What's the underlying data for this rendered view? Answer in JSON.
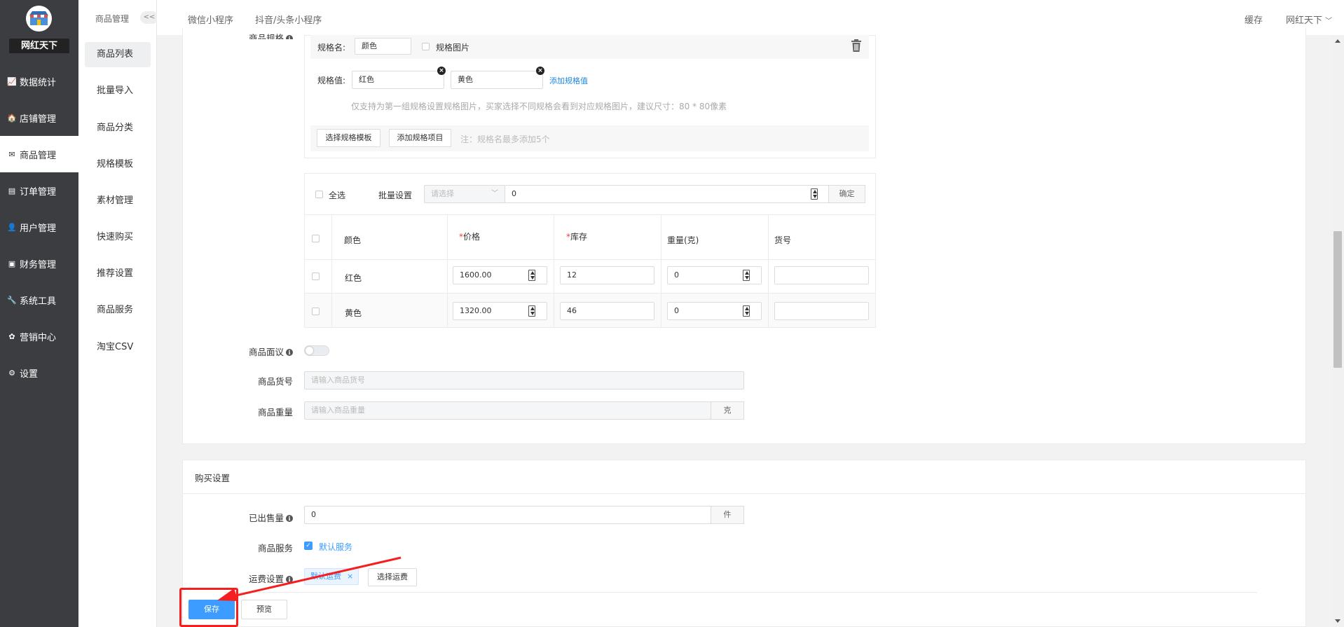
{
  "brand": {
    "name": "网红天下"
  },
  "nav": {
    "items": [
      {
        "label": "数据统计",
        "icon": "chart-icon"
      },
      {
        "label": "店铺管理",
        "icon": "store-icon"
      },
      {
        "label": "商品管理",
        "icon": "goods-icon"
      },
      {
        "label": "订单管理",
        "icon": "order-icon"
      },
      {
        "label": "用户管理",
        "icon": "user-icon"
      },
      {
        "label": "财务管理",
        "icon": "finance-icon"
      },
      {
        "label": "系统工具",
        "icon": "wrench-icon"
      },
      {
        "label": "营销中心",
        "icon": "marketing-icon"
      },
      {
        "label": "设置",
        "icon": "settings-icon"
      }
    ]
  },
  "subnav": {
    "title": "商品管理",
    "collapse": "<<",
    "items": [
      "商品列表",
      "批量导入",
      "商品分类",
      "规格模板",
      "素材管理",
      "快速购买",
      "推荐设置",
      "商品服务",
      "淘宝CSV"
    ]
  },
  "topbar": {
    "tabs": [
      "微信小程序",
      "抖音/头条小程序"
    ],
    "cache": "缓存",
    "user": "网红天下"
  },
  "spec": {
    "section_label": "商品规格",
    "name_label": "规格名:",
    "name_value": "颜色",
    "spec_image_label": "规格图片",
    "value_label": "规格值:",
    "values": [
      "红色",
      "黄色"
    ],
    "add_value": "添加规格值",
    "hint": "仅支持为第一组规格设置规格图片，买家选择不同规格会看到对应规格图片，建议尺寸：80 * 80像素",
    "choose_template": "选择规格模板",
    "add_item": "添加规格项目",
    "note": "注：规格名最多添加5个"
  },
  "batch": {
    "select_all": "全选",
    "label": "批量设置",
    "select_placeholder": "请选择",
    "value": "0",
    "confirm": "确定"
  },
  "sku_table": {
    "headers": [
      "颜色",
      "价格",
      "库存",
      "重量(克)",
      "货号"
    ],
    "rows": [
      {
        "color": "红色",
        "price": "1600.00",
        "stock": "12",
        "weight": "0",
        "sku": ""
      },
      {
        "color": "黄色",
        "price": "1320.00",
        "stock": "46",
        "weight": "0",
        "sku": ""
      }
    ]
  },
  "fields": {
    "negotiable_label": "商品面议",
    "code_label": "商品货号",
    "code_placeholder": "请输入商品货号",
    "weight_label": "商品重量",
    "weight_placeholder": "请输入商品重量",
    "weight_unit": "克"
  },
  "purchase": {
    "section_title": "购买设置",
    "sold_label": "已出售量",
    "sold_value": "0",
    "sold_unit": "件",
    "service_label": "商品服务",
    "service_value": "默认服务",
    "freight_label": "运费设置",
    "freight_tag": "默认运费",
    "freight_choose": "选择运费"
  },
  "actions": {
    "save": "保存",
    "preview": "预览"
  },
  "colors": {
    "primary": "#3c9cff",
    "sidebar": "#3b3d40",
    "annotation": "#f51f1f"
  }
}
